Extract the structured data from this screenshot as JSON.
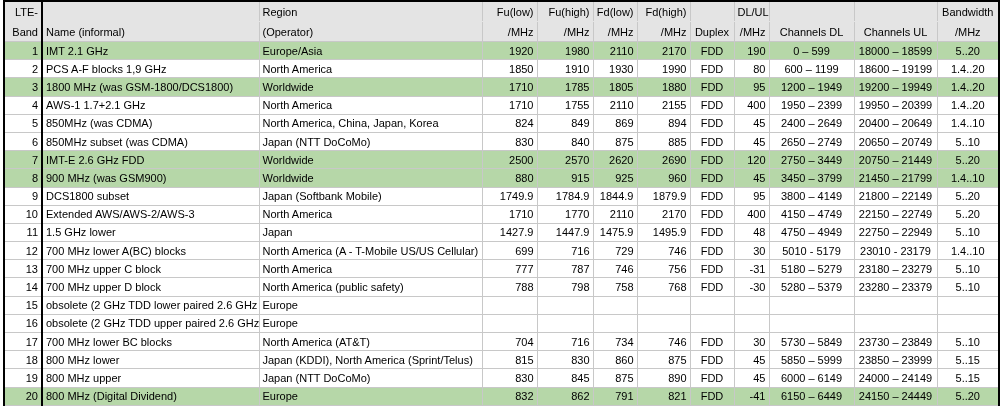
{
  "table": {
    "columns": [
      {
        "top": "LTE-",
        "bottom": "Band"
      },
      {
        "bottom": "Name (informal)"
      },
      {
        "top": "Region",
        "bottom": "(Operator)"
      },
      {
        "top": "Fu(low)",
        "bottom": "/MHz"
      },
      {
        "top": "Fu(high)",
        "bottom": "/MHz"
      },
      {
        "top": "Fd(low)",
        "bottom": "/MHz"
      },
      {
        "top": "Fd(high)",
        "bottom": "/MHz"
      },
      {
        "bottom": "Duplex"
      },
      {
        "top": "DL/UL",
        "bottom": "/MHz"
      },
      {
        "bottom": "Channels DL"
      },
      {
        "bottom": "Channels UL"
      },
      {
        "top": "Bandwidth",
        "bottom": "/MHz"
      }
    ],
    "rows": [
      {
        "highlighted": true,
        "cells": [
          "1",
          "IMT 2.1 GHz",
          "Europe/Asia",
          "1920",
          "1980",
          "2110",
          "2170",
          "FDD",
          "190",
          "0 – 599",
          "18000 – 18599",
          "5..20"
        ]
      },
      {
        "highlighted": false,
        "cells": [
          "2",
          "PCS A-F blocks 1,9 GHz",
          "North America",
          "1850",
          "1910",
          "1930",
          "1990",
          "FDD",
          "80",
          "600 – 1199",
          "18600 – 19199",
          "1.4..20"
        ]
      },
      {
        "highlighted": true,
        "cells": [
          "3",
          "1800 MHz (was GSM-1800/DCS1800)",
          "Worldwide",
          "1710",
          "1785",
          "1805",
          "1880",
          "FDD",
          "95",
          "1200 – 1949",
          "19200 – 19949",
          "1.4..20"
        ]
      },
      {
        "highlighted": false,
        "cells": [
          "4",
          "AWS-1 1.7+2.1 GHz",
          "North America",
          "1710",
          "1755",
          "2110",
          "2155",
          "FDD",
          "400",
          "1950 – 2399",
          "19950 – 20399",
          "1.4..20"
        ]
      },
      {
        "highlighted": false,
        "cells": [
          "5",
          "850MHz (was CDMA)",
          "North America, China, Japan, Korea",
          "824",
          "849",
          "869",
          "894",
          "FDD",
          "45",
          "2400 – 2649",
          "20400 – 20649",
          "1.4..10"
        ]
      },
      {
        "highlighted": false,
        "cells": [
          "6",
          "850MHz subset (was CDMA)",
          "Japan (NTT DoCoMo)",
          "830",
          "840",
          "875",
          "885",
          "FDD",
          "45",
          "2650 – 2749",
          "20650 – 20749",
          "5..10"
        ]
      },
      {
        "highlighted": true,
        "cells": [
          "7",
          "IMT-E 2.6 GHz FDD",
          "Worldwide",
          "2500",
          "2570",
          "2620",
          "2690",
          "FDD",
          "120",
          "2750 – 3449",
          "20750 – 21449",
          "5..20"
        ]
      },
      {
        "highlighted": true,
        "cells": [
          "8",
          "900 MHz (was GSM900)",
          "Worldwide",
          "880",
          "915",
          "925",
          "960",
          "FDD",
          "45",
          "3450 – 3799",
          "21450 – 21799",
          "1.4..10"
        ]
      },
      {
        "highlighted": false,
        "cells": [
          "9",
          "DCS1800 subset",
          "Japan (Softbank Mobile)",
          "1749.9",
          "1784.9",
          "1844.9",
          "1879.9",
          "FDD",
          "95",
          "3800 – 4149",
          "21800 – 22149",
          "5..20"
        ]
      },
      {
        "highlighted": false,
        "cells": [
          "10",
          "Extended AWS/AWS-2/AWS-3",
          "North America",
          "1710",
          "1770",
          "2110",
          "2170",
          "FDD",
          "400",
          "4150 – 4749",
          "22150 – 22749",
          "5..20"
        ]
      },
      {
        "highlighted": false,
        "cells": [
          "11",
          "1.5 GHz lower",
          "Japan",
          "1427.9",
          "1447.9",
          "1475.9",
          "1495.9",
          "FDD",
          "48",
          "4750 – 4949",
          "22750 – 22949",
          "5..10"
        ]
      },
      {
        "highlighted": false,
        "cells": [
          "12",
          "700 MHz lower A(BC) blocks",
          "North America (A - T-Mobile US/US Cellular)",
          "699",
          "716",
          "729",
          "746",
          "FDD",
          "30",
          "5010 - 5179",
          "23010 - 23179",
          "1.4..10"
        ]
      },
      {
        "highlighted": false,
        "cells": [
          "13",
          "700 MHz upper C block",
          "North America",
          "777",
          "787",
          "746",
          "756",
          "FDD",
          "-31",
          "5180 – 5279",
          "23180 – 23279",
          "5..10"
        ]
      },
      {
        "highlighted": false,
        "cells": [
          "14",
          "700 MHz upper D block",
          "North America (public safety)",
          "788",
          "798",
          "758",
          "768",
          "FDD",
          "-30",
          "5280 – 5379",
          "23280 – 23379",
          "5..10"
        ]
      },
      {
        "highlighted": false,
        "cells": [
          "15",
          "obsolete (2 GHz TDD lower paired 2.6 GHz",
          "Europe"
        ]
      },
      {
        "highlighted": false,
        "cells": [
          "16",
          "obsolete (2 GHz TDD upper paired 2.6 GHz",
          "Europe"
        ]
      },
      {
        "highlighted": false,
        "cells": [
          "17",
          "700 MHz lower BC blocks",
          "North America (AT&T)",
          "704",
          "716",
          "734",
          "746",
          "FDD",
          "30",
          "5730 – 5849",
          "23730 – 23849",
          "5..10"
        ]
      },
      {
        "highlighted": false,
        "cells": [
          "18",
          "800 MHz lower",
          "Japan (KDDI), North America (Sprint/Telus)",
          "815",
          "830",
          "860",
          "875",
          "FDD",
          "45",
          "5850 – 5999",
          "23850 – 23999",
          "5..15"
        ]
      },
      {
        "highlighted": false,
        "cells": [
          "19",
          "800 MHz upper",
          "Japan (NTT DoCoMo)",
          "830",
          "845",
          "875",
          "890",
          "FDD",
          "45",
          "6000 – 6149",
          "24000 – 24149",
          "5..15"
        ]
      },
      {
        "highlighted": true,
        "cells": [
          "20",
          "800 MHz (Digital Dividend)",
          "Europe",
          "832",
          "862",
          "791",
          "821",
          "FDD",
          "-41",
          "6150 – 6449",
          "24150 – 24449",
          "5..20"
        ]
      }
    ]
  }
}
